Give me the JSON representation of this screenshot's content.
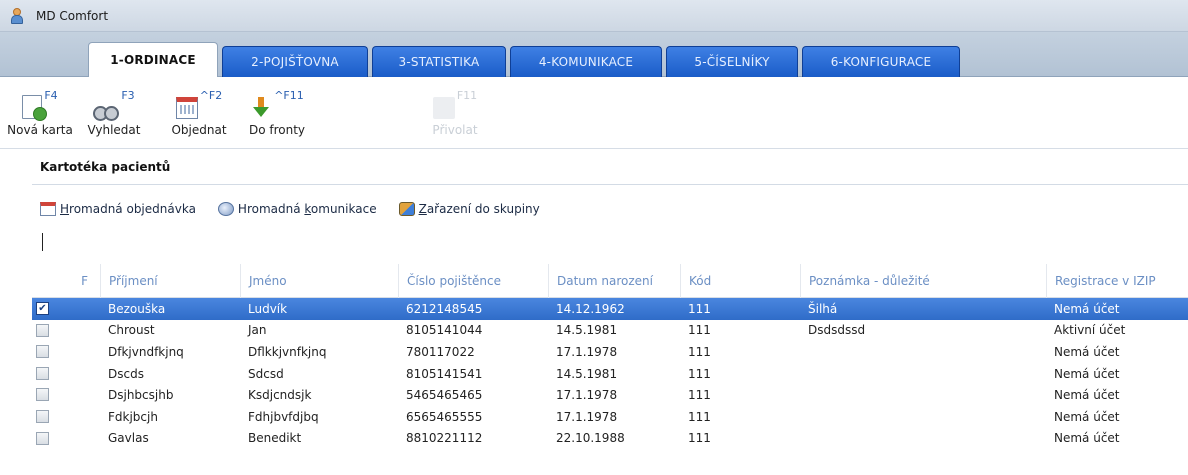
{
  "window": {
    "title": "MD Comfort"
  },
  "tabs": [
    {
      "label": "1-ORDINACE",
      "active": true
    },
    {
      "label": "2-POJIŠŤOVNA",
      "active": false
    },
    {
      "label": "3-STATISTIKA",
      "active": false
    },
    {
      "label": "4-KOMUNIKACE",
      "active": false
    },
    {
      "label": "5-ČÍSELNÍKY",
      "active": false
    },
    {
      "label": "6-KONFIGURACE",
      "active": false
    }
  ],
  "ribbon": {
    "buttons": [
      {
        "label": "Nová karta",
        "hotkey": "F4",
        "icon": "new-card-icon"
      },
      {
        "label": "Vyhledat",
        "hotkey": "F3",
        "icon": "binoculars-icon"
      },
      {
        "label": "Objednat",
        "hotkey": "^F2",
        "icon": "calendar-icon"
      },
      {
        "label": "Do fronty",
        "hotkey": "^F11",
        "icon": "queue-arrow-icon"
      },
      {
        "label": "Přivolat",
        "hotkey": "F11",
        "icon": "call-icon",
        "disabled": true
      }
    ]
  },
  "section": {
    "title": "Kartotéka pacientů"
  },
  "subtoolbar": {
    "bulk_order": {
      "pre": "",
      "u": "H",
      "post": "romadná objednávka"
    },
    "bulk_comm": {
      "pre": "Hromadná ",
      "u": "k",
      "post": "omunikace"
    },
    "add_group": {
      "pre": "",
      "u": "Z",
      "post": "ařazení do skupiny"
    }
  },
  "filter": {
    "value": ""
  },
  "grid": {
    "columns": [
      "F",
      "Příjmení",
      "Jméno",
      "Číslo pojištěnce",
      "Datum narození",
      "Kód",
      "Poznámka - důležité",
      "Registrace v IZIP"
    ],
    "rows": [
      {
        "checked": true,
        "selected": true,
        "prijmeni": "Bezouška",
        "jmeno": "Ludvík",
        "cislo": "6212148545",
        "datum": "14.12.1962",
        "kod": "111",
        "poznamka": "Šilhá",
        "registrace": "Nemá účet"
      },
      {
        "checked": false,
        "selected": false,
        "prijmeni": "Chroust",
        "jmeno": "Jan",
        "cislo": "8105141044",
        "datum": "14.5.1981",
        "kod": "111",
        "poznamka": "Dsdsdssd",
        "registrace": "Aktivní účet"
      },
      {
        "checked": false,
        "selected": false,
        "prijmeni": "Dfkjvndfkjnq",
        "jmeno": "Dflkkjvnfkjnq",
        "cislo": "780117022",
        "datum": "17.1.1978",
        "kod": "111",
        "poznamka": "",
        "registrace": "Nemá účet"
      },
      {
        "checked": false,
        "selected": false,
        "prijmeni": "Dscds",
        "jmeno": "Sdcsd",
        "cislo": "8105141541",
        "datum": "14.5.1981",
        "kod": "111",
        "poznamka": "",
        "registrace": "Nemá účet"
      },
      {
        "checked": false,
        "selected": false,
        "prijmeni": "Dsjhbcsjhb",
        "jmeno": "Ksdjcndsjk",
        "cislo": "5465465465",
        "datum": "17.1.1978",
        "kod": "111",
        "poznamka": "",
        "registrace": "Nemá účet"
      },
      {
        "checked": false,
        "selected": false,
        "prijmeni": "Fdkjbcjh",
        "jmeno": "Fdhjbvfdjbq",
        "cislo": "6565465555",
        "datum": "17.1.1978",
        "kod": "111",
        "poznamka": "",
        "registrace": "Nemá účet"
      },
      {
        "checked": false,
        "selected": false,
        "prijmeni": "Gavlas",
        "jmeno": "Benedikt",
        "cislo": "8810221112",
        "datum": "22.10.1988",
        "kod": "111",
        "poznamka": "",
        "registrace": "Nemá účet"
      }
    ]
  }
}
